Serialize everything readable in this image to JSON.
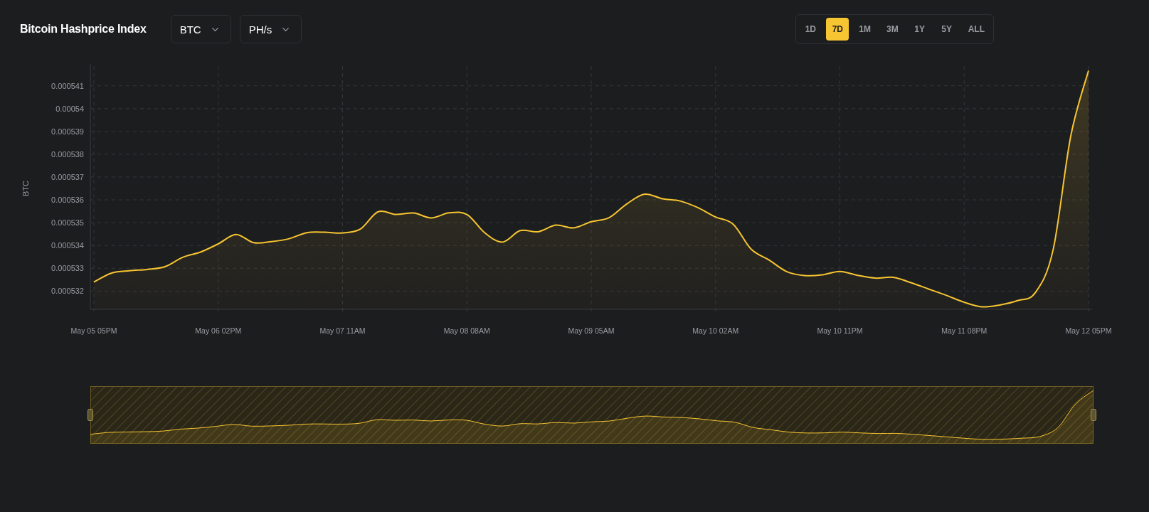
{
  "header": {
    "title": "Bitcoin Hashprice Index",
    "dropdowns": [
      {
        "value": "BTC"
      },
      {
        "value": "PH/s"
      }
    ],
    "ranges": [
      {
        "label": "1D",
        "selected": false
      },
      {
        "label": "7D",
        "selected": true
      },
      {
        "label": "1M",
        "selected": false
      },
      {
        "label": "3M",
        "selected": false
      },
      {
        "label": "1Y",
        "selected": false
      },
      {
        "label": "5Y",
        "selected": false
      },
      {
        "label": "ALL",
        "selected": false
      }
    ]
  },
  "chart": {
    "chart_data": {
      "type": "area",
      "ylabel": "BTC",
      "categories": [
        "May 05 05PM",
        null,
        null,
        null,
        null,
        null,
        null,
        "May 06 02PM",
        null,
        null,
        null,
        null,
        null,
        null,
        "May 07 11AM",
        null,
        null,
        null,
        null,
        null,
        null,
        "May 08 08AM",
        null,
        null,
        null,
        null,
        null,
        null,
        "May 09 05AM",
        null,
        null,
        null,
        null,
        null,
        null,
        "May 10 02AM",
        null,
        null,
        null,
        null,
        null,
        null,
        "May 10 11PM",
        null,
        null,
        null,
        null,
        null,
        null,
        "May 11 08PM",
        null,
        null,
        null,
        null,
        null,
        null,
        "May 12 05PM"
      ],
      "series": [
        {
          "color": "#f7c531",
          "values": [
            0.0005324,
            0.00053279,
            0.00053289,
            0.00053295,
            0.00053307,
            0.00053348,
            0.00053371,
            0.00053407,
            0.00053448,
            0.00053412,
            0.00053417,
            0.0005343,
            0.00053456,
            0.00053458,
            0.00053455,
            0.00053472,
            0.00053548,
            0.00053536,
            0.00053542,
            0.00053521,
            0.00053543,
            0.00053536,
            0.00053456,
            0.00053415,
            0.00053465,
            0.0005346,
            0.00053489,
            0.00053477,
            0.00053504,
            0.00053522,
            0.00053582,
            0.00053625,
            0.00053605,
            0.00053595,
            0.00053566,
            0.00053525,
            0.00053493,
            0.00053384,
            0.00053337,
            0.00053286,
            0.00053268,
            0.00053271,
            0.00053286,
            0.00053269,
            0.00053257,
            0.0005326,
            0.00053237,
            0.00053209,
            0.00053181,
            0.00053151,
            0.00053131,
            0.00053139,
            0.00053158,
            0.00053193,
            0.00053379,
            0.00053879,
            0.00054167
          ]
        }
      ],
      "ylim": [
        0.0005312,
        0.0005418
      ],
      "grid": true,
      "yticks": [
        {
          "value": 0.000532,
          "label": "0.000532"
        },
        {
          "value": 0.000533,
          "label": "0.000533"
        },
        {
          "value": 0.000534,
          "label": "0.000534"
        },
        {
          "value": 0.000535,
          "label": "0.000535"
        },
        {
          "value": 0.000536,
          "label": "0.000536"
        },
        {
          "value": 0.000537,
          "label": "0.000537"
        },
        {
          "value": 0.000538,
          "label": "0.000538"
        },
        {
          "value": 0.000539,
          "label": "0.000539"
        },
        {
          "value": 0.00054,
          "label": "0.00054"
        },
        {
          "value": 0.000541,
          "label": "0.000541"
        }
      ]
    }
  }
}
